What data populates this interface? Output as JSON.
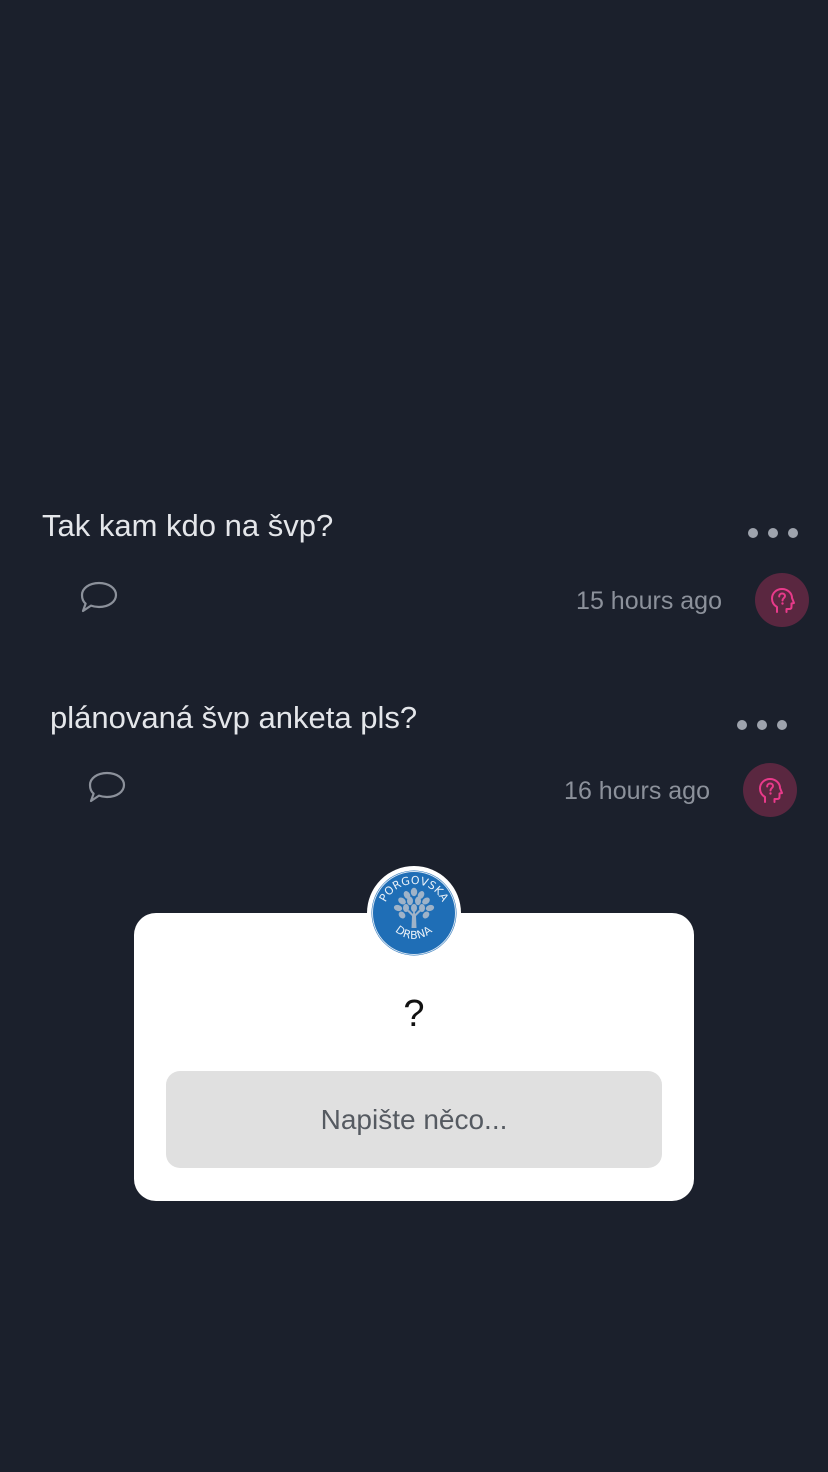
{
  "posts": [
    {
      "text": "Tak kam kdo na švp?",
      "time": "15 hours ago",
      "avatar_icon": "anonymous-head-question-icon",
      "comment_icon": "speech-bubble-icon",
      "more_icon": "ellipsis-icon"
    },
    {
      "text": "plánovaná švp anketa pls?",
      "time": "16 hours ago",
      "avatar_icon": "anonymous-head-question-icon",
      "comment_icon": "speech-bubble-icon",
      "more_icon": "ellipsis-icon"
    }
  ],
  "modal": {
    "logo": {
      "text_top": "PORGOVSKA",
      "text_bottom": "DRBNA",
      "colors": {
        "bg": "#1f6eb6",
        "tree": "#9fb3c8",
        "ring": "#ffffff"
      }
    },
    "question": "?",
    "input_placeholder": "Napište něco...",
    "input_value": ""
  },
  "colors": {
    "background": "#1b202c",
    "accent_pink": "#e83a8a",
    "avatar_bg": "#5a2740"
  }
}
